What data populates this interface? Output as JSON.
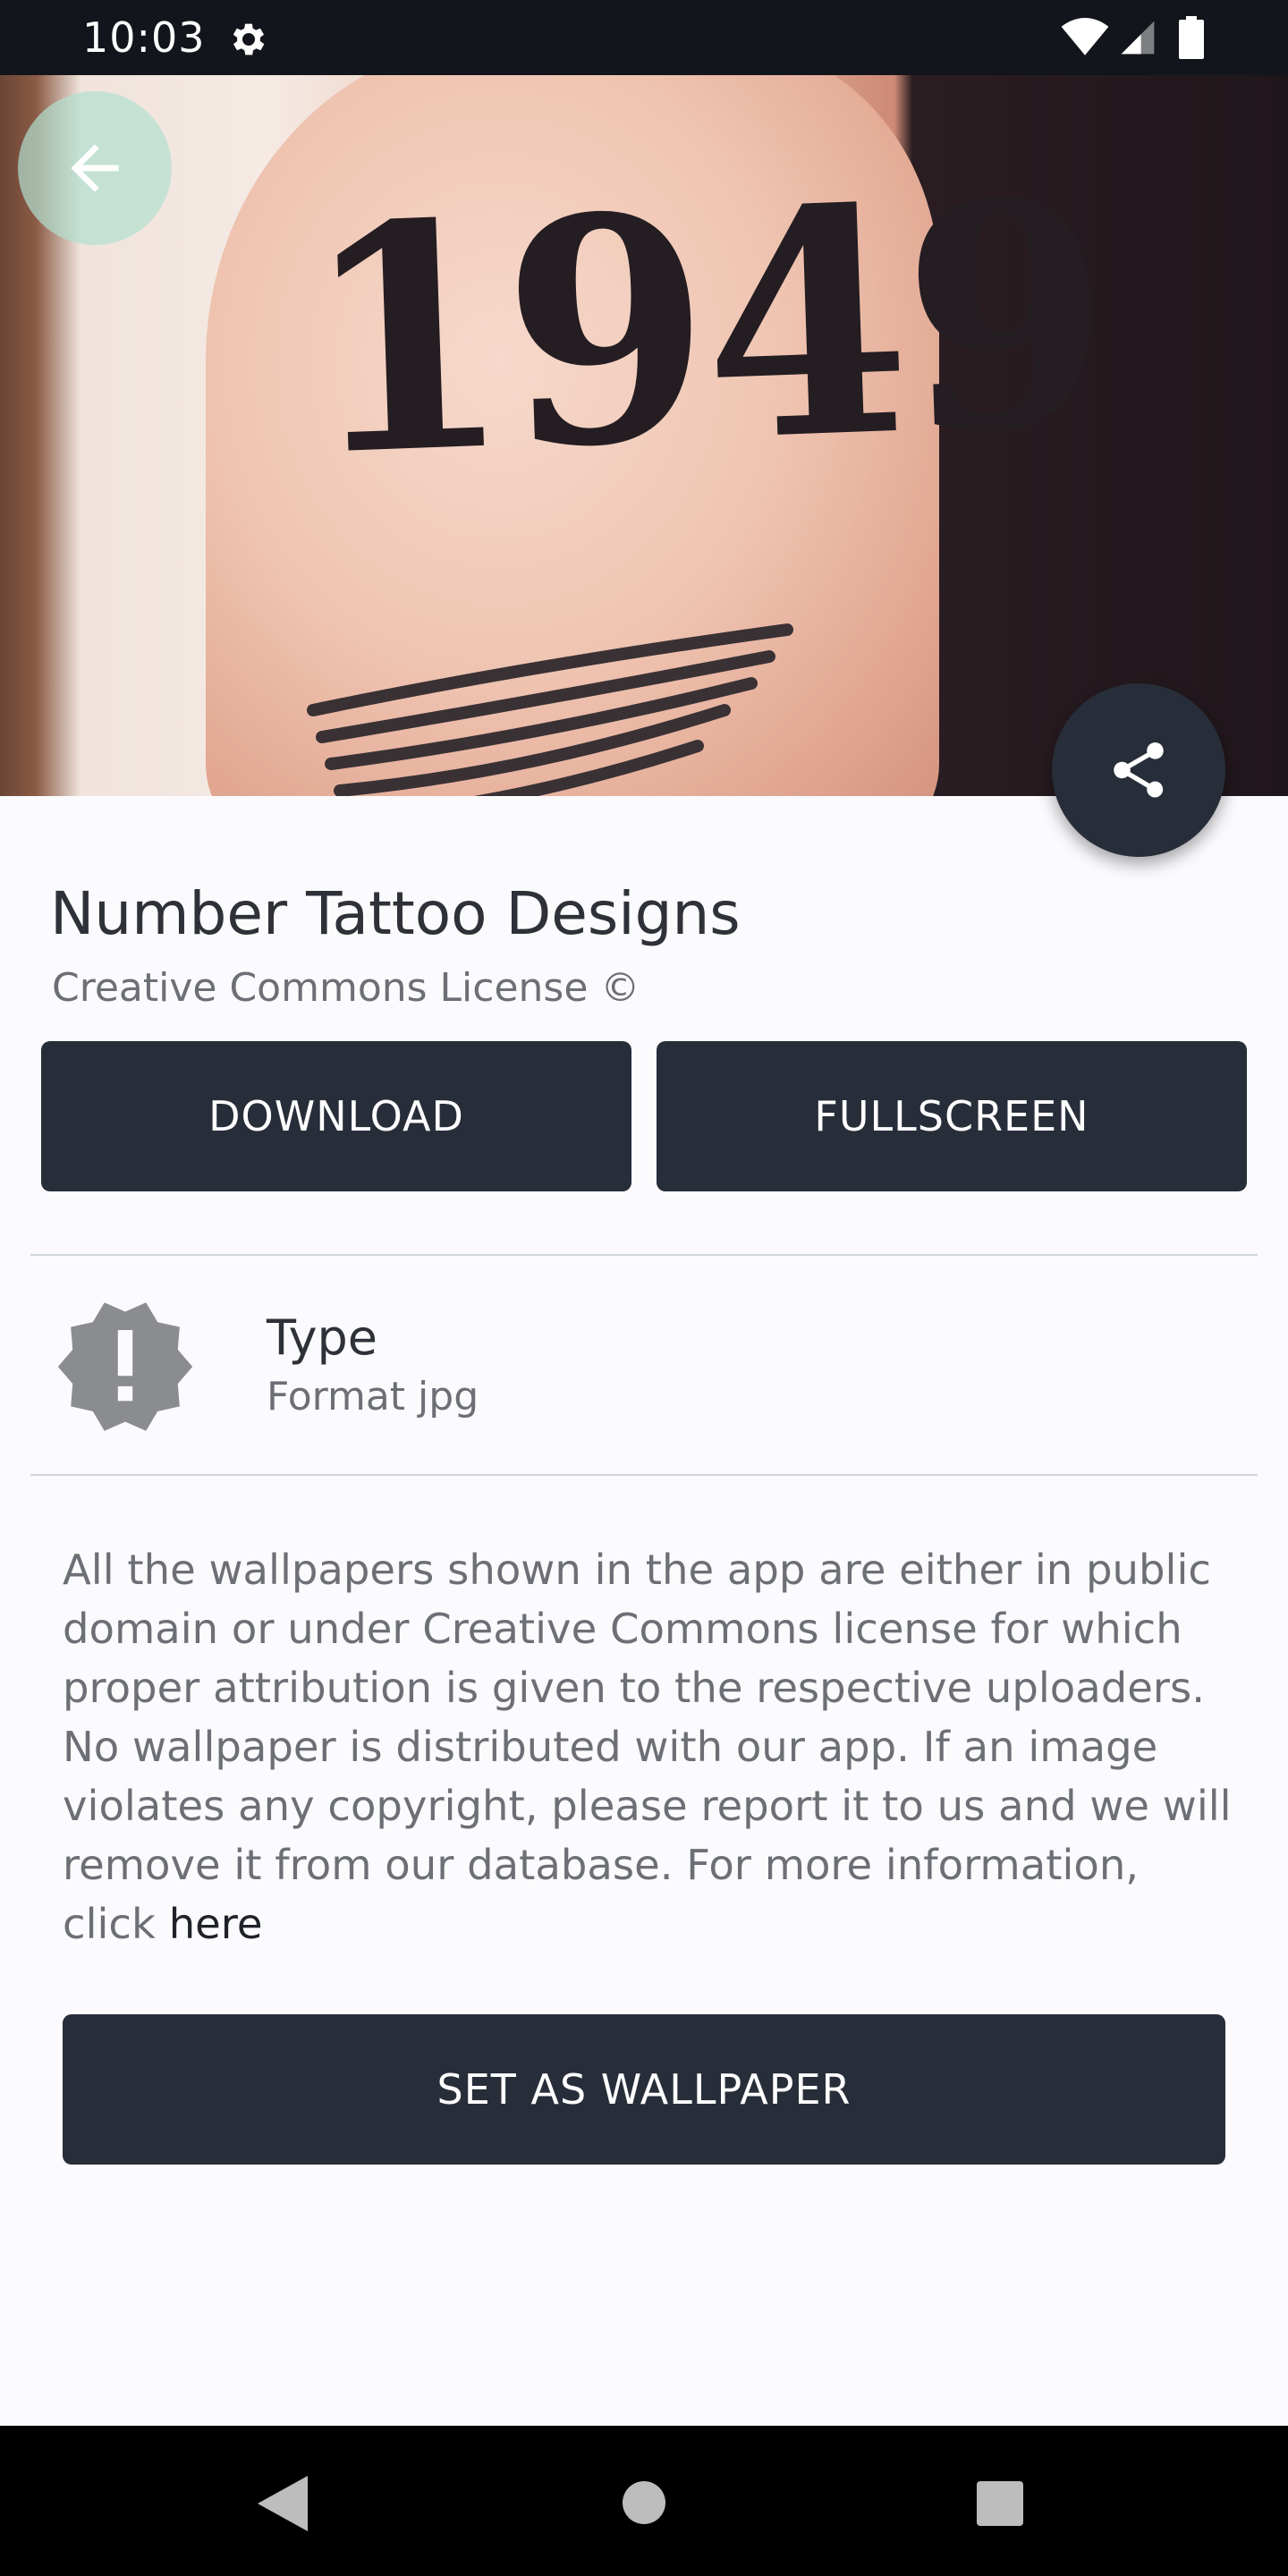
{
  "status_bar": {
    "time": "10:03",
    "icons": [
      "settings-gear-icon",
      "wifi-icon",
      "cellular-signal-icon",
      "battery-icon"
    ]
  },
  "hero": {
    "image_text": "1949",
    "back_icon": "arrow-back-icon",
    "share_icon": "share-icon"
  },
  "details": {
    "title": "Number Tattoo Designs",
    "subtitle": "Creative Commons License ©"
  },
  "actions": {
    "download_label": "DOWNLOAD",
    "fullscreen_label": "FULLSCREEN",
    "set_wallpaper_label": "SET AS WALLPAPER"
  },
  "info": {
    "icon": "alert-badge-icon",
    "title": "Type",
    "value": "Format jpg"
  },
  "disclaimer": {
    "text": "All the wallpapers shown in the app are either in public domain or under Creative Commons license for which proper attribution is given to the respective uploaders. No wallpaper is distributed with our app. If an image violates any copyright, please report it to us and we will remove it from our database. For more information, click",
    "link_text": "here"
  },
  "nav_bar": {
    "icons": [
      "nav-back-icon",
      "nav-home-icon",
      "nav-recents-icon"
    ]
  },
  "colors": {
    "primary_dark": "#272e39",
    "background": "#fbfafd",
    "text_primary": "#2e3138",
    "text_secondary": "#6c6f75",
    "back_button_tint": "#b2dfd0"
  }
}
